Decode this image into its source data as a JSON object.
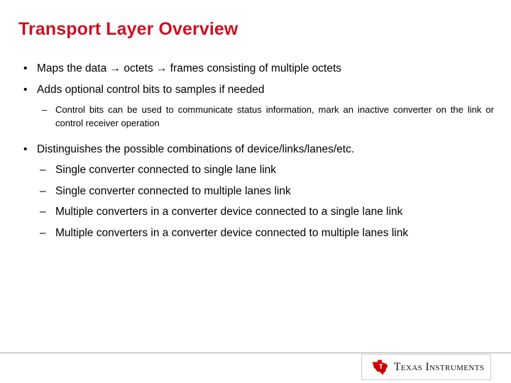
{
  "slide": {
    "title": "Transport Layer Overview",
    "title_color": "#cc1122",
    "background_color": "#ffffff",
    "bullet_marker": "•",
    "dash_marker": "–",
    "bullets": [
      {
        "text": "Maps the data → octets → frames consisting of multiple octets"
      },
      {
        "text": " Adds optional control bits to samples if needed"
      },
      {
        "text": "Control bits can be used to communicate status information, mark an inactive converter on the link or control receiver operation"
      },
      {
        "text": "Distinguishes the possible combinations of device/links/lanes/etc."
      },
      {
        "text": "Single converter connected to single lane link"
      },
      {
        "text": "Single converter connected to multiple lanes link"
      },
      {
        "text": "Multiple converters in a converter device connected to a single lane link"
      },
      {
        "text": "Multiple converters in a converter device connected to multiple lanes link"
      }
    ]
  },
  "footer": {
    "logo_text": "Texas Instruments",
    "logo_mark_color": "#cc0000",
    "rule_color": "#a8a8a8"
  }
}
